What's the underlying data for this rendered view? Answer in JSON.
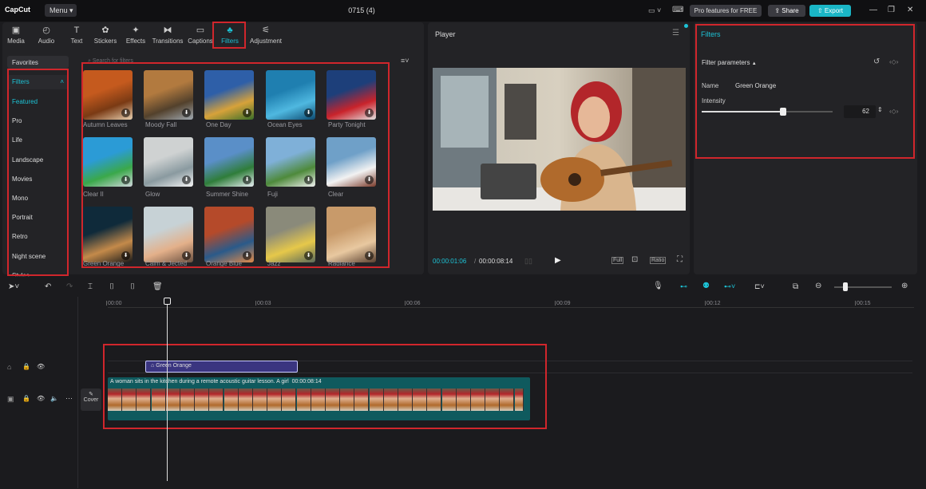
{
  "app": {
    "logo": "CapCut",
    "menu": "Menu",
    "project_title": "0715 (4)",
    "pro_label": "Pro features for FREE",
    "share_label": "Share",
    "export_label": "Export"
  },
  "toolbar": [
    {
      "label": "Media",
      "icon": "media-icon"
    },
    {
      "label": "Audio",
      "icon": "audio-icon"
    },
    {
      "label": "Text",
      "icon": "text-icon"
    },
    {
      "label": "Stickers",
      "icon": "stickers-icon"
    },
    {
      "label": "Effects",
      "icon": "effects-icon"
    },
    {
      "label": "Transitions",
      "icon": "transitions-icon"
    },
    {
      "label": "Captions",
      "icon": "captions-icon"
    },
    {
      "label": "Filters",
      "icon": "filters-icon"
    },
    {
      "label": "Adjustment",
      "icon": "adjustment-icon"
    }
  ],
  "sidebar": {
    "favorites": "Favorites",
    "filters": "Filters",
    "items": [
      "Featured",
      "Pro",
      "Life",
      "Landscape",
      "Movies",
      "Mono",
      "Portrait",
      "Retro",
      "Night scene",
      "Styles"
    ]
  },
  "search": {
    "placeholder": "Search for filters"
  },
  "filters": [
    "Autumn Leaves",
    "Moody Fall",
    "One Day",
    "Ocean Eyes",
    "Party Tonight",
    "Clear II",
    "Glow",
    "Summer Shine",
    "Fuji",
    "Clear",
    "Green Orange",
    "Calm & Jected",
    "Orange Blue",
    "Jazz",
    "Radiance"
  ],
  "player": {
    "title": "Player",
    "current_time": "00:00:01:06",
    "total_time": "00:00:08:14",
    "full": "Full",
    "ratio": "Ratio"
  },
  "inspector": {
    "title": "Filters",
    "section": "Filter parameters",
    "name_label": "Name",
    "name_value": "Green Orange",
    "intensity_label": "Intensity",
    "intensity_value": "62",
    "intensity_fraction": 0.62
  },
  "timeline": {
    "ruler": [
      "00:00",
      "00:03",
      "00:06",
      "00:09",
      "00:12",
      "00:15"
    ],
    "filter_clip": "Green Orange",
    "video_clip": "A woman sits in the kitchen during a remote acoustic guitar lesson. A girl",
    "video_duration": "00:00:08:14",
    "cover": "Cover"
  },
  "colors": {
    "accent": "#1dc3d6",
    "highlight": "#d0262c",
    "filter_clip": "#3a3580",
    "video_clip": "#0f5a5e"
  }
}
